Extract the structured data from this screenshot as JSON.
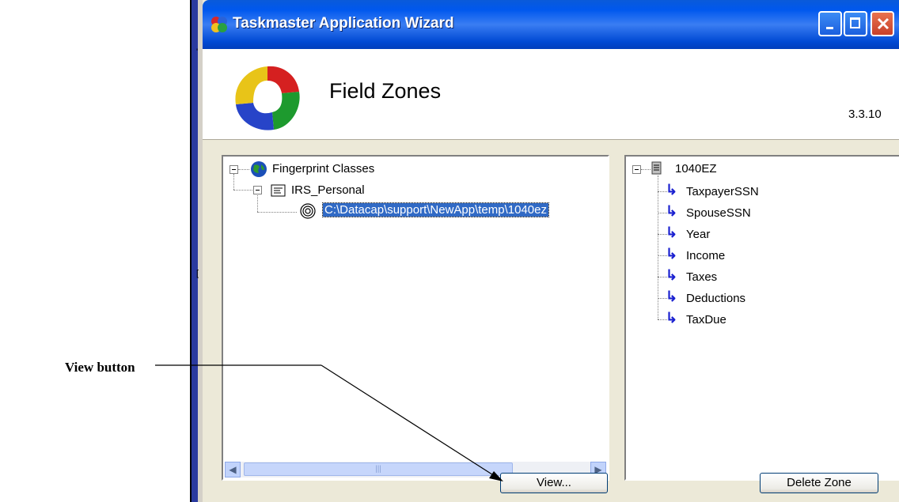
{
  "annotation": {
    "label": "View button"
  },
  "window": {
    "title": "Taskmaster Application Wizard",
    "page_title": "Field Zones",
    "version": "3.3.10"
  },
  "left_tree": {
    "root": "Fingerprint Classes",
    "class": "IRS_Personal",
    "file": "C:\\Datacap\\support\\NewApp\\temp\\1040ez"
  },
  "right_tree": {
    "root": "1040EZ",
    "fields": [
      "TaxpayerSSN",
      "SpouseSSN",
      "Year",
      "Income",
      "Taxes",
      "Deductions",
      "TaxDue"
    ]
  },
  "buttons": {
    "view": "View...",
    "delete_zone": "Delete Zone"
  },
  "colors": {
    "title_bar": "#0058ee",
    "selection": "#316ac5",
    "field_arrow": "#1a20d0"
  }
}
